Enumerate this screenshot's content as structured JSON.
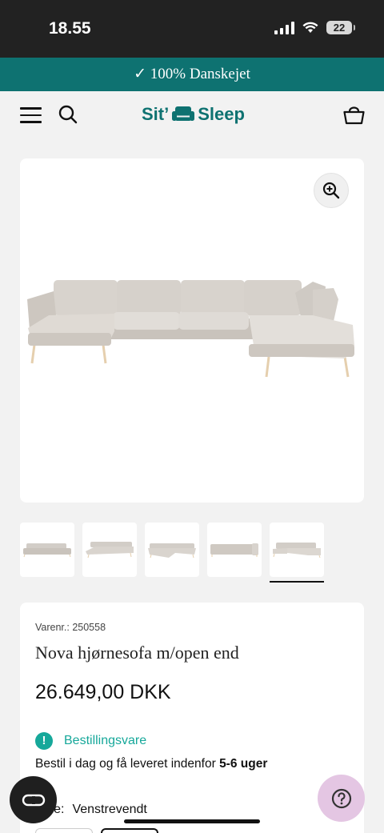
{
  "status_bar": {
    "time": "18.55",
    "battery": "22"
  },
  "promo": {
    "text": "✓ 100% Danskejet"
  },
  "header": {
    "logo_left": "Sit’",
    "logo_right": "Sleep"
  },
  "product": {
    "sku": "Varenr.: 250558",
    "title": "Nova hjørnesofa m/open end",
    "price": "26.649,00 DKK",
    "stock_label": "Bestillingsvare",
    "delivery_prefix": "Bestil i dag og få leveret indenfor ",
    "delivery_time": "5-6 uger",
    "variant_label": "Side:",
    "variant_value": "Venstrevendt"
  },
  "colors": {
    "brand": "#0e7271",
    "stock": "#16a89a",
    "help_bg": "#e4c6e3"
  },
  "icons": [
    "menu-icon",
    "search-icon",
    "cart-icon",
    "zoom-icon",
    "chat-icon",
    "help-icon"
  ]
}
